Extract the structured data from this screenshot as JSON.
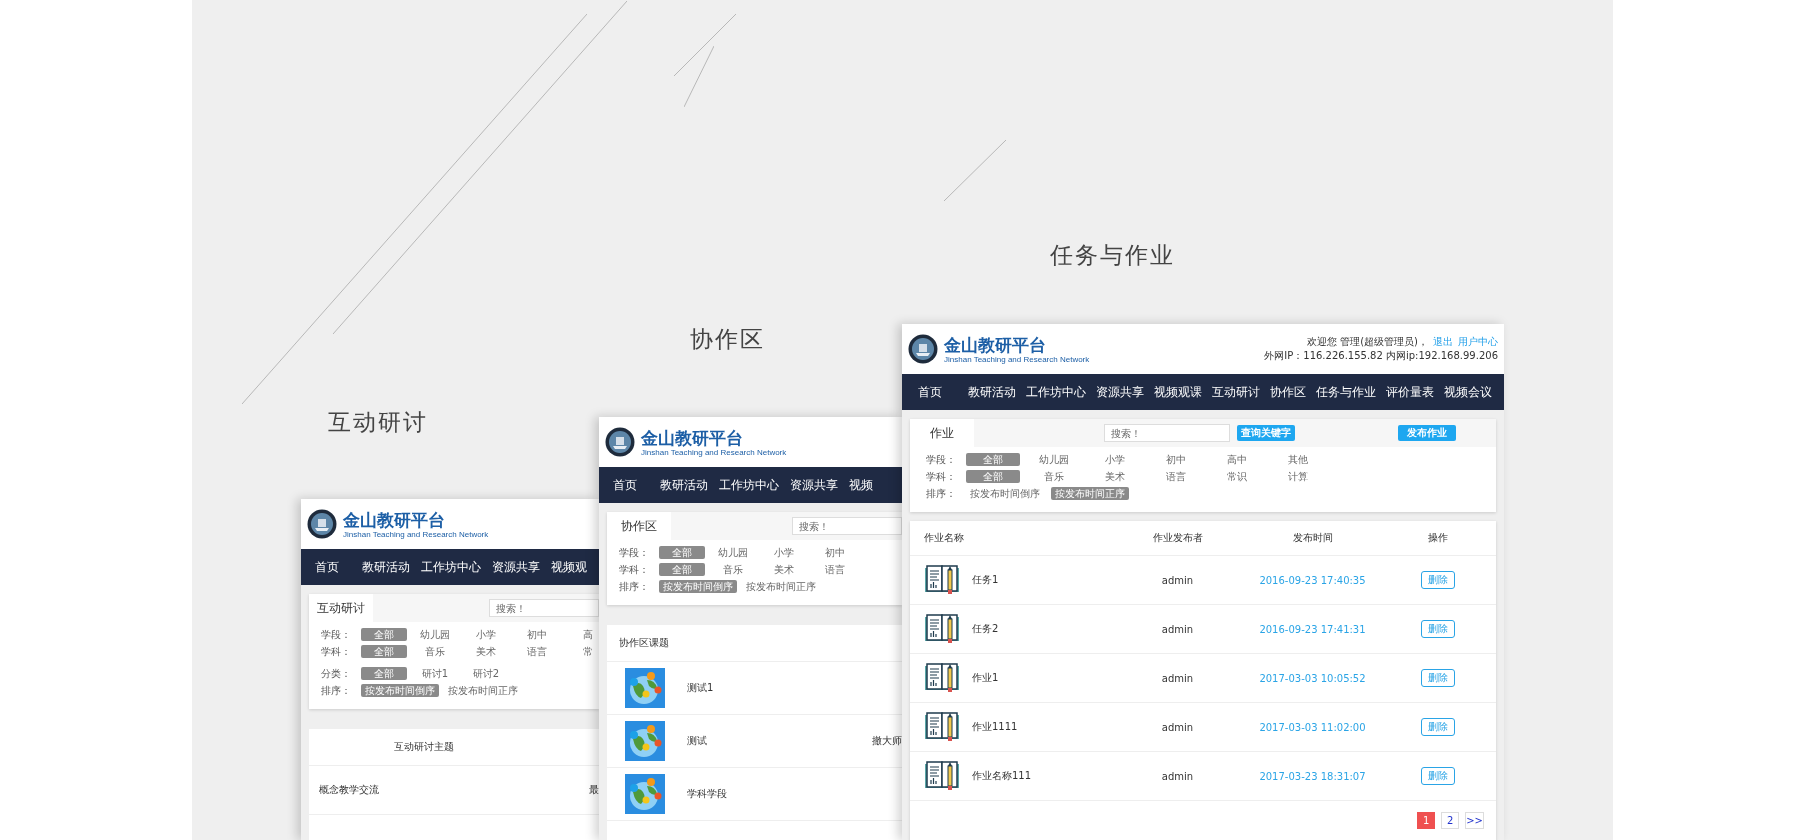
{
  "cards": [
    {
      "kind": "discussion",
      "caption": "互动研讨",
      "logo": {
        "title": "金山教研平台",
        "subtitle": "Jinshan Teaching and Research Network"
      },
      "nav": [
        "首页",
        "教研活动",
        "工作坊中心",
        "资源共享",
        "视频观"
      ],
      "panel": {
        "tab": "互动研讨",
        "search": {
          "placeholder": "搜索！"
        },
        "filters": [
          {
            "label": "学段：",
            "options": [
              {
                "text": "全部",
                "selected": true
              },
              {
                "text": "幼儿园",
                "selected": false
              },
              {
                "text": "小学",
                "selected": false
              },
              {
                "text": "初中",
                "selected": false
              },
              {
                "text": "高",
                "selected": false
              }
            ]
          },
          {
            "label": "学科：",
            "options": [
              {
                "text": "全部",
                "selected": true
              },
              {
                "text": "音乐",
                "selected": false
              },
              {
                "text": "美术",
                "selected": false
              },
              {
                "text": "语言",
                "selected": false
              },
              {
                "text": "常",
                "selected": false
              }
            ]
          },
          {
            "label": "分类：",
            "options": [
              {
                "text": "全部",
                "selected": true
              },
              {
                "text": "研讨1",
                "selected": false
              },
              {
                "text": "研讨2",
                "selected": false
              }
            ]
          },
          {
            "label": "排序：",
            "options": [
              {
                "text": "按发布时间倒序",
                "selected": true
              },
              {
                "text": "按发布时间正序",
                "selected": false
              }
            ]
          }
        ]
      },
      "list": {
        "header": "互动研讨主题",
        "rows": [
          {
            "title": "概念教学交流",
            "column_2": "最"
          }
        ]
      }
    },
    {
      "kind": "collab",
      "caption": "协作区",
      "logo": {
        "title": "金山教研平台",
        "subtitle": "Jinshan Teaching and Research Network"
      },
      "nav": [
        "首页",
        "教研活动",
        "工作坊中心",
        "资源共享",
        "视频"
      ],
      "panel": {
        "tab": "协作区",
        "search": {
          "placeholder": "搜索！"
        },
        "filters": [
          {
            "label": "学段：",
            "options": [
              {
                "text": "全部",
                "selected": true
              },
              {
                "text": "幼儿园",
                "selected": false
              },
              {
                "text": "小学",
                "selected": false
              },
              {
                "text": "初中",
                "selected": false
              }
            ]
          },
          {
            "label": "学科：",
            "options": [
              {
                "text": "全部",
                "selected": true
              },
              {
                "text": "音乐",
                "selected": false
              },
              {
                "text": "美术",
                "selected": false
              },
              {
                "text": "语言",
                "selected": false
              }
            ]
          },
          {
            "label": "排序：",
            "options": [
              {
                "text": "按发布时间倒序",
                "selected": true
              },
              {
                "text": "按发布时间正序",
                "selected": false
              }
            ]
          }
        ]
      },
      "list": {
        "header": "协作区课题",
        "rows": [
          {
            "title": "测试1"
          },
          {
            "title": "测试",
            "column_2": "撤大师"
          },
          {
            "title": "学科学段"
          }
        ]
      }
    },
    {
      "kind": "homework",
      "caption": "任务与作业",
      "logo": {
        "title": "金山教研平台",
        "subtitle": "Jinshan Teaching and Research Network"
      },
      "user": {
        "greeting": "欢迎您 管理(超级管理员)，",
        "links": [
          "退出",
          "用户中心"
        ],
        "ip": "外网IP：116.226.155.82 内网ip:192.168.99.206"
      },
      "nav": [
        "首页",
        "教研活动",
        "工作坊中心",
        "资源共享",
        "视频观课",
        "互动研讨",
        "协作区",
        "任务与作业",
        "评价量表",
        "视频会议"
      ],
      "panel": {
        "tab": "作业",
        "search": {
          "placeholder": "搜索！"
        },
        "search_button": "查询关键字",
        "publish_button": "发布作业",
        "filters": [
          {
            "label": "学段：",
            "options": [
              {
                "text": "全部",
                "selected": true
              },
              {
                "text": "幼儿园",
                "selected": false
              },
              {
                "text": "小学",
                "selected": false
              },
              {
                "text": "初中",
                "selected": false
              },
              {
                "text": "高中",
                "selected": false
              },
              {
                "text": "其他",
                "selected": false
              }
            ]
          },
          {
            "label": "学科：",
            "options": [
              {
                "text": "全部",
                "selected": true
              },
              {
                "text": "音乐",
                "selected": false
              },
              {
                "text": "美术",
                "selected": false
              },
              {
                "text": "语言",
                "selected": false
              },
              {
                "text": "常识",
                "selected": false
              },
              {
                "text": "计算",
                "selected": false
              }
            ]
          },
          {
            "label": "排序：",
            "options": [
              {
                "text": "按发布时间倒序",
                "selected": false
              },
              {
                "text": "按发布时间正序",
                "selected": true
              }
            ]
          }
        ]
      },
      "table": {
        "columns": [
          "作业名称",
          "作业发布者",
          "发布时间",
          "操作"
        ],
        "rows": [
          {
            "name": "任务1",
            "publisher": "admin",
            "time": "2016-09-23 17:40:35",
            "action": "删除"
          },
          {
            "name": "任务2",
            "publisher": "admin",
            "time": "2016-09-23 17:41:31",
            "action": "删除"
          },
          {
            "name": "作业1",
            "publisher": "admin",
            "time": "2017-03-03 10:05:52",
            "action": "删除"
          },
          {
            "name": "作业1111",
            "publisher": "admin",
            "time": "2017-03-03 11:02:00",
            "action": "删除"
          },
          {
            "name": "作业名称111",
            "publisher": "admin",
            "time": "2017-03-23 18:31:07",
            "action": "删除"
          }
        ]
      },
      "pagination": [
        {
          "label": "1",
          "selected": true
        },
        {
          "label": "2",
          "selected": false
        },
        {
          "label": ">>",
          "selected": false
        }
      ]
    }
  ]
}
